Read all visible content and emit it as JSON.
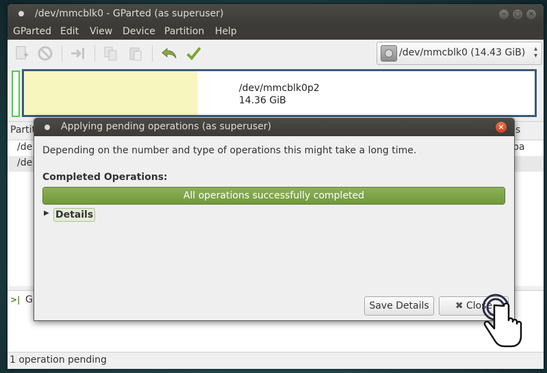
{
  "window": {
    "title": "/dev/mmcblk0 - GParted (as superuser)"
  },
  "menubar": {
    "items": [
      "GParted",
      "Edit",
      "View",
      "Device",
      "Partition",
      "Help"
    ]
  },
  "toolbar": {
    "icons": [
      "new-partition-icon",
      "delete-icon",
      "resize-move-icon",
      "copy-icon",
      "paste-icon",
      "undo-icon",
      "apply-icon"
    ],
    "device_selector": "/dev/mmcblk0  (14.43 GiB)"
  },
  "partition_map": {
    "partition_name": "/dev/mmcblk0p2",
    "partition_size": "14.36 GiB",
    "used_fraction": 0.34,
    "colors": {
      "used": "#f8f6bf",
      "border": "#3a5a79",
      "unallocated": "#44d044"
    }
  },
  "partition_list": {
    "header_left": "Partiti",
    "header_right": "s",
    "rows": [
      "/de",
      "/de"
    ],
    "row_right_fragment": "pa"
  },
  "operations": {
    "item_fragment": "Gr"
  },
  "statusbar": {
    "text": "1 operation pending"
  },
  "dialog": {
    "title": "Applying pending operations (as superuser)",
    "description": "Depending on the number and type of operations this might take a long time.",
    "completed_heading": "Completed Operations:",
    "progress_text": "All operations successfully completed",
    "progress_fraction": 1.0,
    "details_label": "Details",
    "save_details_button": "Save Details",
    "close_button": "Close",
    "colors": {
      "progress": "#7fa64a",
      "close_circle": "#e2532f"
    }
  }
}
